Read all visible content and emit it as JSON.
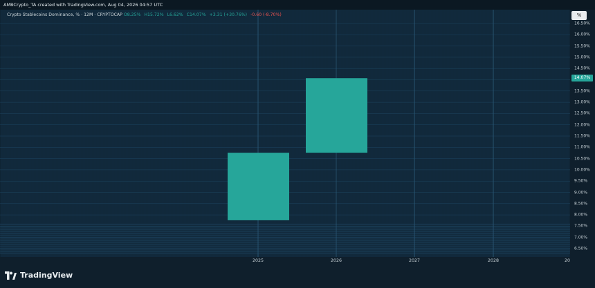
{
  "header": {
    "text": "AMBCrypto_TA created with TradingView.com, Aug 04, 2026 04:57 UTC"
  },
  "legend": {
    "title": "Crypto Stablecoins Dominance, % · 12M · CRYPTOCAP",
    "open": "O8.25%",
    "high": "H15.72%",
    "low": "L6.62%",
    "close": "C14.07%",
    "change_pos": "+3.31 (+30.76%)",
    "change_neg": "-0.60 (-8.70%)"
  },
  "price_axis": {
    "ticks": [
      "16.50%",
      "16.00%",
      "15.50%",
      "15.00%",
      "14.50%",
      "14.00%",
      "13.50%",
      "13.00%",
      "12.50%",
      "12.00%",
      "11.50%",
      "11.00%",
      "10.50%",
      "10.00%",
      "9.50%",
      "9.00%",
      "8.50%",
      "8.00%",
      "7.50%",
      "7.00%",
      "6.50%"
    ],
    "current_price_label": "14.07%"
  },
  "time_axis": {
    "ticks": [
      "2025",
      "2026",
      "2027",
      "2028",
      "20"
    ]
  },
  "percent_toggle_label": "%",
  "brand": {
    "name": "TradingView"
  },
  "colors": {
    "up": "#26a69a",
    "down": "#ef5350",
    "background": "#0f2434"
  },
  "chart_data": {
    "type": "candlestick",
    "series": [
      {
        "name": "2025",
        "open": 7.76,
        "close": 10.76
      },
      {
        "name": "2026",
        "open": 10.76,
        "close": 14.07
      }
    ],
    "y_ticks": [
      16.5,
      16.0,
      15.5,
      15.0,
      14.5,
      14.0,
      13.5,
      13.0,
      12.5,
      12.0,
      11.5,
      11.0,
      10.5,
      10.0,
      9.5,
      9.0,
      8.5,
      8.0,
      7.5,
      7.0,
      6.5
    ],
    "x_ticks": [
      "2025",
      "2026",
      "2027",
      "2028",
      "20"
    ],
    "ylim": [
      6.25,
      16.75
    ]
  }
}
